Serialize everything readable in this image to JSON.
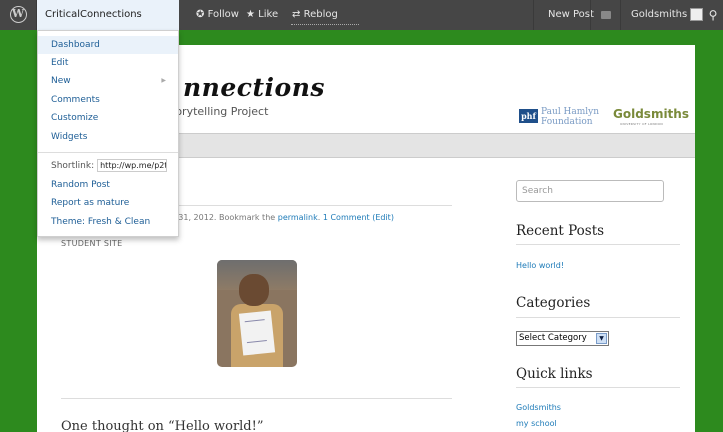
{
  "admin_bar": {
    "site_name": "CriticalConnections",
    "follow": "Follow",
    "like": "Like",
    "reblog": "Reblog",
    "new_post": "New Post",
    "user": "Goldsmiths",
    "dropdown": {
      "items": [
        "Dashboard",
        "Edit",
        "New",
        "Comments",
        "Customize",
        "Widgets"
      ],
      "shortlink_label": "Shortlink:",
      "shortlink_value": "http://wp.me/p2t\\",
      "items2": [
        "Random Post",
        "Report as mature",
        "Theme: Fresh & Clean"
      ]
    }
  },
  "header": {
    "logo_text": "nnections",
    "tagline": "torytelling Project",
    "phf_abbr": "phf",
    "phf_line1": "Paul Hamlyn",
    "phf_line2": "Foundation",
    "goldsmiths": "Goldsmiths",
    "goldsmiths_sub": "UNIVERSITY OF LONDON"
  },
  "post": {
    "meta_prefix": "y 31, 2012. Bookmark the ",
    "permalink": "permalink",
    "meta_sep": ". ",
    "comments_link": "1 Comment (Edit)",
    "category": "STUDENT SITE",
    "comments_title": "One thought on “Hello world!”"
  },
  "sidebar": {
    "search_placeholder": "Search",
    "recent_title": "Recent Posts",
    "recent_link": "Hello world!",
    "categories_title": "Categories",
    "select_value": "Select Category",
    "quick_title": "Quick links",
    "quick_links": [
      "Goldsmiths",
      "my school"
    ]
  },
  "colors": {
    "background": "#2d8a1e",
    "admin_bar": "#464646",
    "link": "#1e7bb8"
  }
}
